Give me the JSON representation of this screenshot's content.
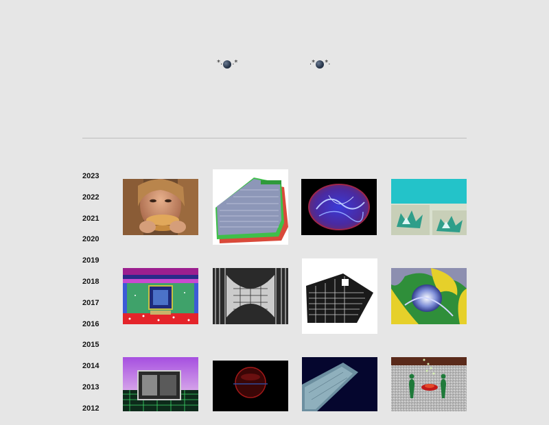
{
  "header": {
    "logo_left": {
      "left_deco": "*.",
      "right_deco": ".*"
    },
    "logo_right": {
      "left_deco": ".*",
      "right_deco": "*."
    }
  },
  "years": [
    "2023",
    "2022",
    "2021",
    "2020",
    "2019",
    "2018",
    "2017",
    "2016",
    "2015",
    "2014",
    "2013",
    "2012"
  ],
  "gallery": [
    {
      "name": "thumb-burger-woman"
    },
    {
      "name": "thumb-green-shape"
    },
    {
      "name": "thumb-blue-oval"
    },
    {
      "name": "thumb-cyan-leaves"
    },
    {
      "name": "thumb-glitch-window"
    },
    {
      "name": "thumb-bw-pattern"
    },
    {
      "name": "thumb-bw-house"
    },
    {
      "name": "thumb-fluid-blob"
    },
    {
      "name": "thumb-purple-grid"
    },
    {
      "name": "thumb-red-orb"
    },
    {
      "name": "thumb-blue-diagonal"
    },
    {
      "name": "thumb-statues-noise"
    }
  ]
}
